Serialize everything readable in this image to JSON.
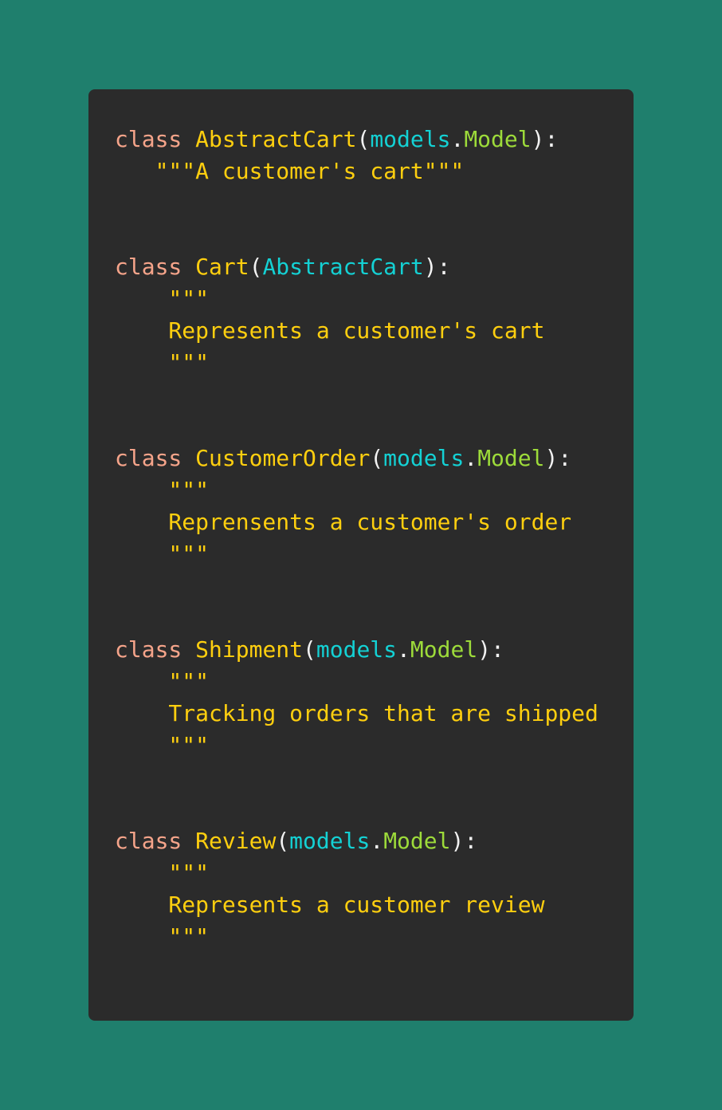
{
  "colors": {
    "background": "#1f7f6d",
    "editor_background": "#2b2b2b",
    "keyword": "#f5a48a",
    "class_name": "#ffcf0f",
    "module": "#14d1d4",
    "base_class": "#9ddb3a",
    "punctuation": "#f2f2f2",
    "docstring": "#ffcf0f"
  },
  "code": {
    "keyword": "class",
    "blocks": [
      {
        "class_name": "AbstractCart",
        "open_paren": "(",
        "module": "models",
        "dot": ".",
        "base": "Model",
        "close": "):",
        "docstring_inline": "   \"\"\"A customer's cart\"\"\""
      },
      {
        "class_name": "Cart",
        "open_paren": "(",
        "inherits": "AbstractCart",
        "close": "):",
        "doc_open": "    \"\"\"",
        "doc_text": "    Represents a customer's cart",
        "doc_close": "    \"\"\""
      },
      {
        "class_name": "CustomerOrder",
        "open_paren": "(",
        "module": "models",
        "dot": ".",
        "base": "Model",
        "close": "):",
        "doc_open": "    \"\"\"",
        "doc_text": "    Reprensents a customer's order",
        "doc_close": "    \"\"\""
      },
      {
        "class_name": "Shipment",
        "open_paren": "(",
        "module": "models",
        "dot": ".",
        "base": "Model",
        "close": "):",
        "doc_open": "    \"\"\"",
        "doc_text": "    Tracking orders that are shipped",
        "doc_close": "    \"\"\""
      },
      {
        "class_name": "Review",
        "open_paren": "(",
        "module": "models",
        "dot": ".",
        "base": "Model",
        "close": "):",
        "doc_open": "    \"\"\"",
        "doc_text": "    Represents a customer review",
        "doc_close": "    \"\"\""
      }
    ]
  }
}
